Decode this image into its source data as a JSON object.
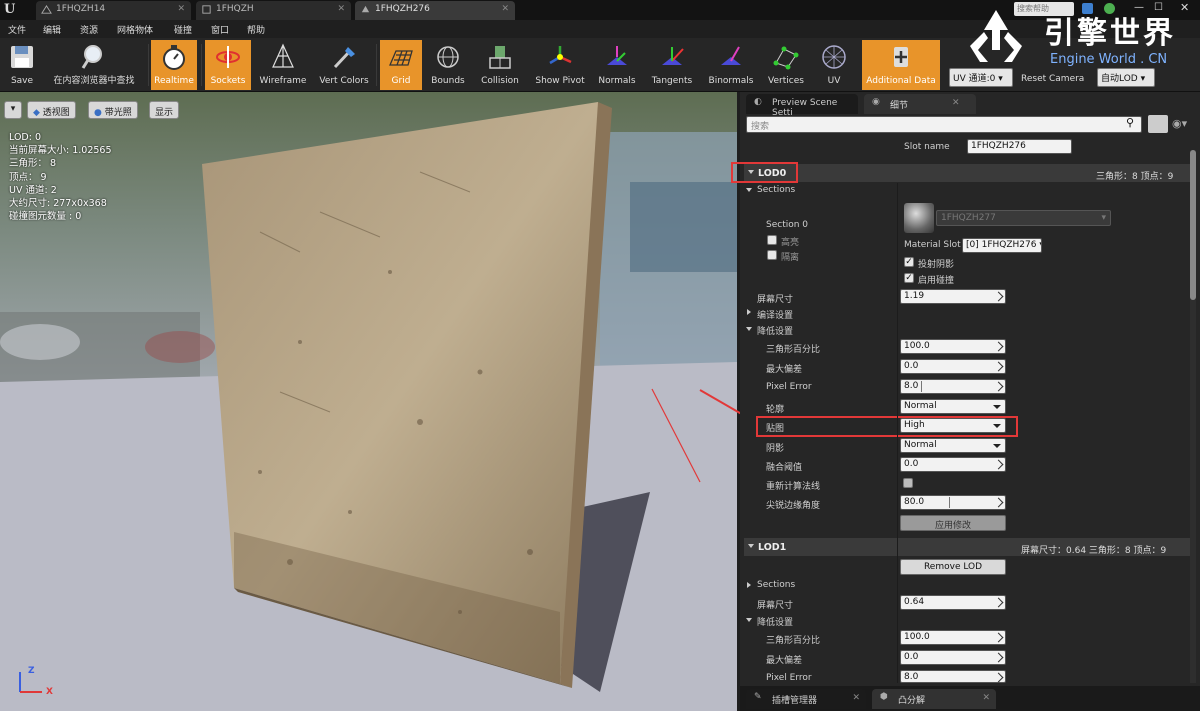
{
  "tabs": [
    {
      "label": "1FHQZH14"
    },
    {
      "label": "1FHQZH"
    },
    {
      "label": "1FHQZH276"
    }
  ],
  "title_search_placeholder": "搜索帮助",
  "menu": [
    "文件",
    "编辑",
    "资源",
    "网格物体",
    "碰撞",
    "窗口",
    "帮助"
  ],
  "toolbar": {
    "items": [
      {
        "label": "Save",
        "icon": "save-icon"
      },
      {
        "label": "在内容浏览器中查找",
        "icon": "magnifier-icon"
      },
      {
        "label": "Realtime",
        "icon": "stopwatch-icon"
      },
      {
        "label": "Sockets",
        "icon": "sockets-icon"
      },
      {
        "label": "Wireframe",
        "icon": "wireframe-icon"
      },
      {
        "label": "Vert Colors",
        "icon": "vert-colors-icon"
      },
      {
        "label": "Grid",
        "icon": "grid-icon"
      },
      {
        "label": "Bounds",
        "icon": "bounds-icon"
      },
      {
        "label": "Collision",
        "icon": "collision-icon"
      },
      {
        "label": "Show Pivot",
        "icon": "pivot-icon"
      },
      {
        "label": "Normals",
        "icon": "normals-icon"
      },
      {
        "label": "Tangents",
        "icon": "tangents-icon"
      },
      {
        "label": "Binormals",
        "icon": "binormals-icon"
      },
      {
        "label": "Vertices",
        "icon": "vertices-icon"
      },
      {
        "label": "UV",
        "icon": "uv-icon"
      },
      {
        "label": "Additional Data",
        "icon": "additional-data-icon"
      }
    ],
    "uv_channel": "UV 通道:0",
    "reset_camera": "Reset Camera",
    "auto_lod": "自动LOD"
  },
  "watermark": {
    "title": "引擎世界",
    "sub": "Engine World . CN"
  },
  "viewport": {
    "buttons": [
      "透视图",
      "带光照",
      "显示"
    ],
    "stats": [
      "LOD: 0",
      "当前屏幕大小: 1.02565",
      "三角形： 8",
      "顶点： 9",
      "UV 通道: 2",
      "大约尺寸: 277x0x368",
      "碰撞图元数量 : 0"
    ],
    "axis_z": "Z",
    "axis_x": "X"
  },
  "panel": {
    "tab_preview": "Preview Scene Setti",
    "tab_details": "细节",
    "search_placeholder": "搜索",
    "slot_name_label": "Slot name",
    "slot_name_value": "1FHQZH276",
    "lod0": {
      "title": "LOD0",
      "stats": "三角形：8  顶点：9",
      "sections": "Sections",
      "section0": "Section 0",
      "highlight": "高亮",
      "isolate": "隔离",
      "material": "1FHQZH277",
      "material_slot_label": "Material Slot",
      "material_slot_value": "[0] 1FHQZH276",
      "cast_shadow": "投射阴影",
      "enable_collision": "启用碰撞",
      "screen_size_label": "屏幕尺寸",
      "screen_size": "1.19",
      "build_settings": "编译设置",
      "reduction_settings": "降低设置",
      "triangle_percent_label": "三角形百分比",
      "triangle_percent": "100.0",
      "max_deviation_label": "最大偏差",
      "max_deviation": "0.0",
      "pixel_error_label": "Pixel Error",
      "pixel_error": "8.0",
      "silhouette_label": "轮廓",
      "silhouette": "Normal",
      "texture_label": "贴图",
      "texture": "High",
      "shading_label": "阴影",
      "shading": "Normal",
      "weld_threshold_label": "融合阈值",
      "weld_threshold": "0.0",
      "recompute_normals_label": "重新计算法线",
      "hard_angle_label": "尖锐边缘角度",
      "hard_angle": "80.0",
      "apply_changes": "应用修改"
    },
    "lod1": {
      "title": "LOD1",
      "stats": "屏幕尺寸：0.64  三角形：8  顶点：9",
      "remove_lod": "Remove LOD",
      "sections": "Sections",
      "screen_size_label": "屏幕尺寸",
      "screen_size": "0.64",
      "reduction_settings": "降低设置",
      "triangle_percent_label": "三角形百分比",
      "triangle_percent": "100.0",
      "max_deviation_label": "最大偏差",
      "max_deviation": "0.0",
      "pixel_error_label": "Pixel Error",
      "pixel_error": "8.0"
    },
    "bottom_tabs": [
      "插槽管理器",
      "凸分解"
    ]
  },
  "colors": {
    "accent_orange": "#e8942a",
    "highlight_red": "#e23838"
  }
}
